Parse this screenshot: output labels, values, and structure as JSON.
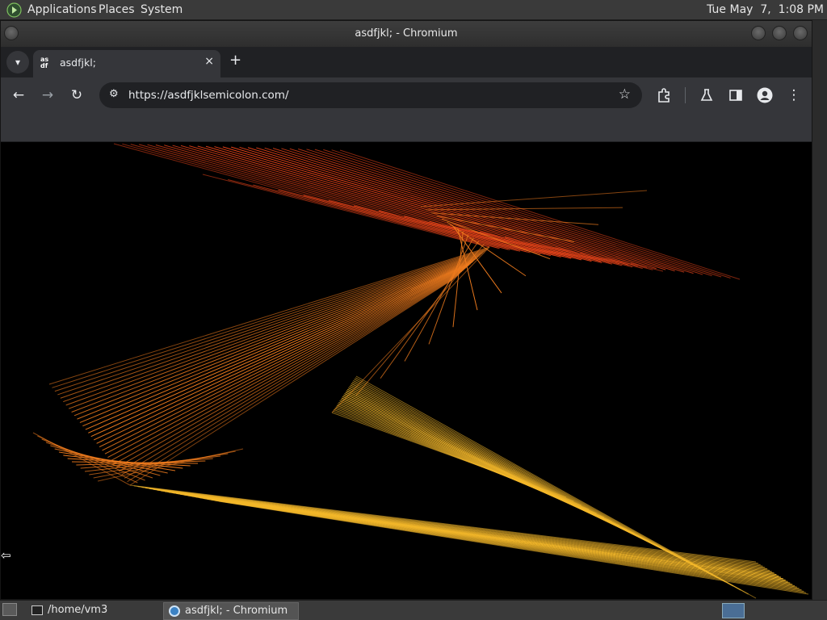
{
  "top_panel": {
    "menus": [
      "Applications",
      "Places",
      "System"
    ],
    "clock": "Tue May  7,  1:08 PM"
  },
  "window": {
    "title": "asdfjkl; - Chromium"
  },
  "tabs": [
    {
      "title": "asdfjkl;",
      "favicon_text": "as df",
      "close": "×"
    }
  ],
  "new_tab": "+",
  "toolbar": {
    "url": "https://asdfjklsemicolon.com/"
  },
  "taskbar": {
    "items": [
      {
        "label": "/home/vm3",
        "icon": "terminal-icon"
      },
      {
        "label": "asdfjkl; - Chromium",
        "icon": "chromium-icon"
      }
    ]
  },
  "colors": {
    "canvas_background": "#000000",
    "line_red": "#e8441a",
    "line_orange": "#f07c1e",
    "line_yellow": "#f4b82a"
  }
}
